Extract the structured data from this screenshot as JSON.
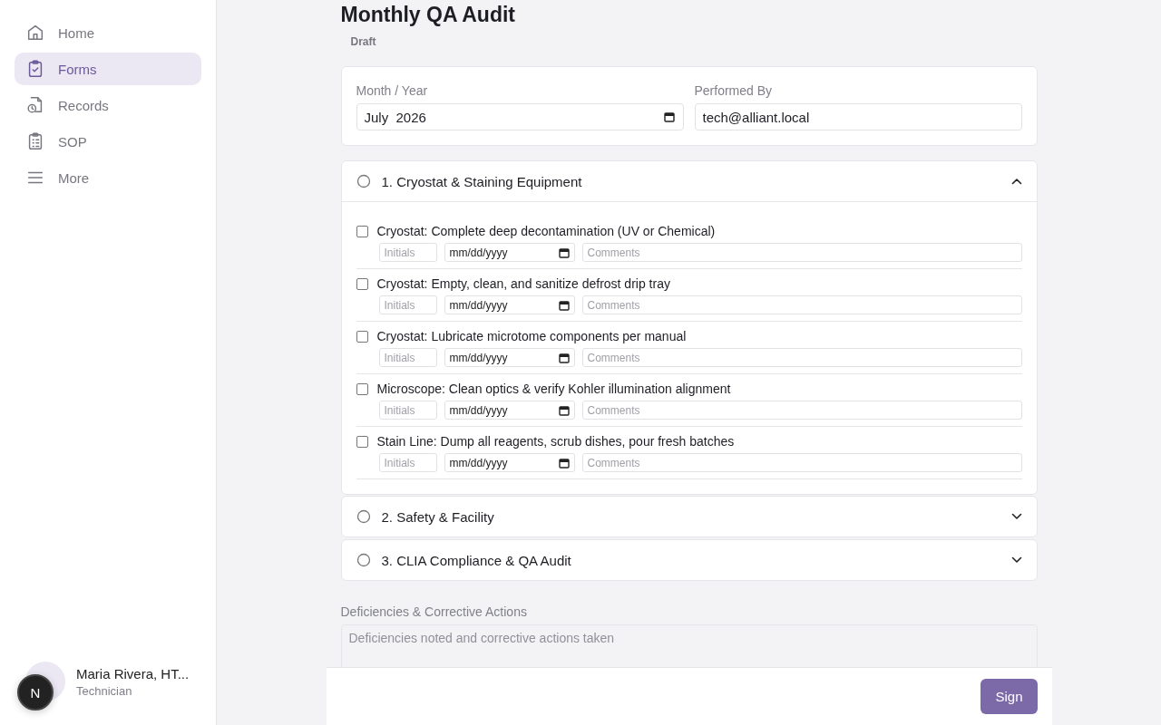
{
  "sidebar": {
    "items": [
      {
        "label": "Home",
        "selected": false
      },
      {
        "label": "Forms",
        "selected": true
      },
      {
        "label": "Records",
        "selected": false
      },
      {
        "label": "SOP",
        "selected": false
      },
      {
        "label": "More",
        "selected": false
      }
    ],
    "user": {
      "name": "Maria Rivera, HT...",
      "role": "Technician"
    },
    "dev_badge": "N"
  },
  "title": "Monthly QA Audit",
  "status": "Draft",
  "header_fields": [
    {
      "label": "Month / Year",
      "value": "July  2026",
      "kind": "month"
    },
    {
      "label": "Performed By",
      "value": "tech@alliant.local",
      "kind": "text"
    }
  ],
  "sections": [
    {
      "title": "1. Cryostat & Staining Equipment",
      "expanded": true,
      "items": [
        {
          "label": "Cryostat: Complete deep decontamination (UV or Chemical)",
          "checked": false,
          "initials_placeholder": "Initials",
          "date_placeholder": "mm/dd/yyyy",
          "comments_placeholder": "Comments"
        },
        {
          "label": "Cryostat: Empty, clean, and sanitize defrost drip tray",
          "checked": false,
          "initials_placeholder": "Initials",
          "date_placeholder": "mm/dd/yyyy",
          "comments_placeholder": "Comments"
        },
        {
          "label": "Cryostat: Lubricate microtome components per manual",
          "checked": false,
          "initials_placeholder": "Initials",
          "date_placeholder": "mm/dd/yyyy",
          "comments_placeholder": "Comments"
        },
        {
          "label": "Microscope: Clean optics & verify Kohler illumination alignment",
          "checked": false,
          "initials_placeholder": "Initials",
          "date_placeholder": "mm/dd/yyyy",
          "comments_placeholder": "Comments"
        },
        {
          "label": "Stain Line: Dump all reagents, scrub dishes, pour fresh batches",
          "checked": false,
          "initials_placeholder": "Initials",
          "date_placeholder": "mm/dd/yyyy",
          "comments_placeholder": "Comments"
        }
      ]
    },
    {
      "title": "2. Safety & Facility",
      "expanded": false
    },
    {
      "title": "3. CLIA Compliance & QA Audit",
      "expanded": false
    }
  ],
  "deficiencies": {
    "label": "Deficiencies & Corrective Actions",
    "placeholder": "Deficiencies noted and corrective actions taken"
  },
  "sign_button": "Sign"
}
